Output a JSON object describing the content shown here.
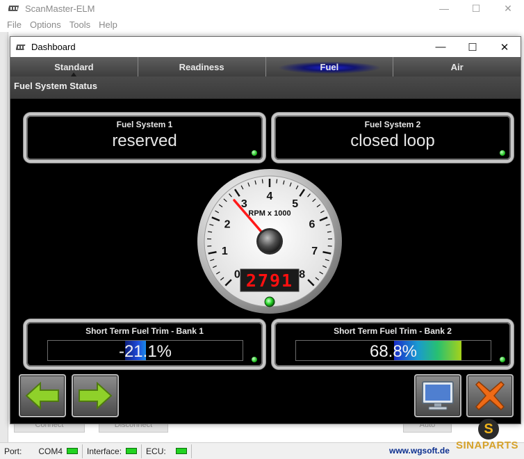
{
  "app": {
    "title": "ScanMaster-ELM",
    "menu": [
      "File",
      "Options",
      "Tools",
      "Help"
    ]
  },
  "window_controls": {
    "minimize": "—",
    "maximize": "☐",
    "close": "✕"
  },
  "background_buttons": {
    "connect": "Connect",
    "disconnect": "Disconnect",
    "auto": "Auto"
  },
  "dashboard": {
    "title": "Dashboard",
    "tabs": [
      "Standard",
      "Readiness",
      "Fuel",
      "Air"
    ],
    "active_tab": "Fuel",
    "section_title": "Fuel System Status",
    "fuel_system_1": {
      "label": "Fuel System 1",
      "value": "reserved"
    },
    "fuel_system_2": {
      "label": "Fuel System 2",
      "value": "closed loop"
    },
    "gauge": {
      "label": "RPM x 1000",
      "scale": [
        "0",
        "1",
        "2",
        "3",
        "4",
        "5",
        "6",
        "7",
        "8"
      ],
      "digital_readout": "2791",
      "needle_value": 2.791
    },
    "trim_bank1": {
      "label": "Short Term Fuel Trim - Bank 1",
      "value": "-21.1%",
      "level": -21.1
    },
    "trim_bank2": {
      "label": "Short Term Fuel Trim - Bank 2",
      "value": "68.8%",
      "level": 68.8
    }
  },
  "statusbar": {
    "port_label": "Port:",
    "port_value": "COM4",
    "interface_label": "Interface:",
    "ecu_label": "ECU:",
    "website": "www.wgsoft.de"
  },
  "watermark": "SINAPARTS",
  "colors": {
    "led_green": "#21d321",
    "tab_active_glow": "#1d22d8",
    "close_button": "#e8681a",
    "arrow_green": "#8fd12a"
  }
}
